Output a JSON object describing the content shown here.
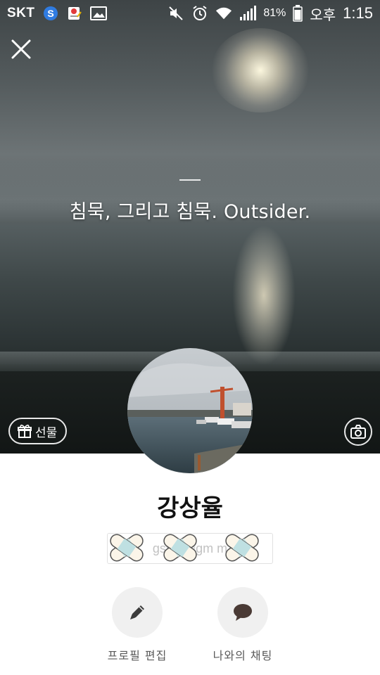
{
  "status_bar": {
    "carrier": "SKT",
    "battery_percent": "81%",
    "ampm": "오후",
    "time": "1:15",
    "icons": [
      "s-app-icon",
      "gs-notification-icon",
      "image-notification-icon",
      "mute-icon",
      "alarm-icon",
      "wifi-icon",
      "signal-icon",
      "battery-icon"
    ]
  },
  "cover": {
    "status_message": "침묵, 그리고 침묵. Outsider.",
    "gift_label": "선물"
  },
  "profile": {
    "name": "강상율",
    "email_partial": "gsy1   @gm   m"
  },
  "actions": {
    "edit_profile": "프로필 편집",
    "chat_with_me": "나와의 채팅"
  },
  "colors": {
    "action_circle": "#f0f0f0",
    "icon_dark": "#3c3c3c",
    "chat_bubble": "#4a3a35"
  }
}
